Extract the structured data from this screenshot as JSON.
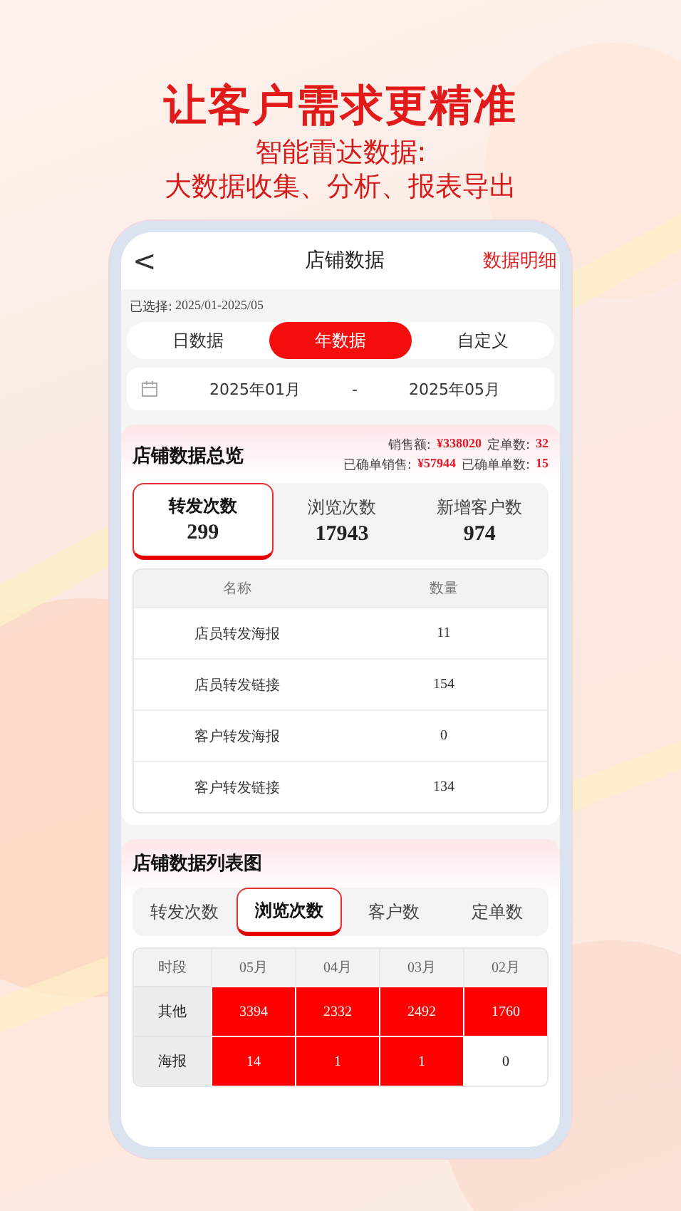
{
  "promo": {
    "headline": "让客户需求更精准",
    "subline_1": "智能雷达数据:",
    "subline_2": "大数据收集、分析、报表导出"
  },
  "header": {
    "back": "<",
    "title": "店铺数据",
    "action": "数据明细"
  },
  "selected_range": {
    "label": "已选择:",
    "value": "2025/01-2025/05"
  },
  "period_tabs": [
    {
      "label": "日数据",
      "selected": false
    },
    {
      "label": "年数据",
      "selected": true
    },
    {
      "label": "自定义",
      "selected": false
    }
  ],
  "date_range": {
    "start": "2025年01月",
    "separator": "-",
    "end": "2025年05月"
  },
  "overview": {
    "title": "店铺数据总览",
    "stats_1": [
      {
        "label": "销售额:",
        "value": "¥338020"
      },
      {
        "label": "定单数:",
        "value": "32"
      }
    ],
    "stats_2": [
      {
        "label": "已确单销售:",
        "value": "¥57944"
      },
      {
        "label": "已确单单数:",
        "value": "15"
      }
    ],
    "metric_tabs": [
      {
        "label": "转发次数",
        "value": "299",
        "selected": true
      },
      {
        "label": "浏览次数",
        "value": "17943",
        "selected": false
      },
      {
        "label": "新增客户数",
        "value": "974",
        "selected": false
      }
    ],
    "table": {
      "columns": [
        "名称",
        "数量"
      ],
      "rows": [
        [
          "店员转发海报",
          "11"
        ],
        [
          "店员转发链接",
          "154"
        ],
        [
          "客户转发海报",
          "0"
        ],
        [
          "客户转发链接",
          "134"
        ]
      ]
    }
  },
  "chart_list": {
    "title": "店铺数据列表图",
    "tabs": [
      {
        "label": "转发次数",
        "selected": false
      },
      {
        "label": "浏览次数",
        "selected": true
      },
      {
        "label": "客户数",
        "selected": false
      },
      {
        "label": "定单数",
        "selected": false
      }
    ],
    "row_header": "时段",
    "columns": [
      "05月",
      "04月",
      "03月",
      "02月"
    ],
    "rows": [
      {
        "label": "其他",
        "cells": [
          {
            "value": "3394",
            "highlighted": true
          },
          {
            "value": "2332",
            "highlighted": true
          },
          {
            "value": "2492",
            "highlighted": true
          },
          {
            "value": "1760",
            "highlighted": true
          }
        ]
      },
      {
        "label": "海报",
        "cells": [
          {
            "value": "14",
            "highlighted": true
          },
          {
            "value": "1",
            "highlighted": true
          },
          {
            "value": "1",
            "highlighted": true
          },
          {
            "value": "0",
            "highlighted": false
          }
        ]
      }
    ]
  }
}
